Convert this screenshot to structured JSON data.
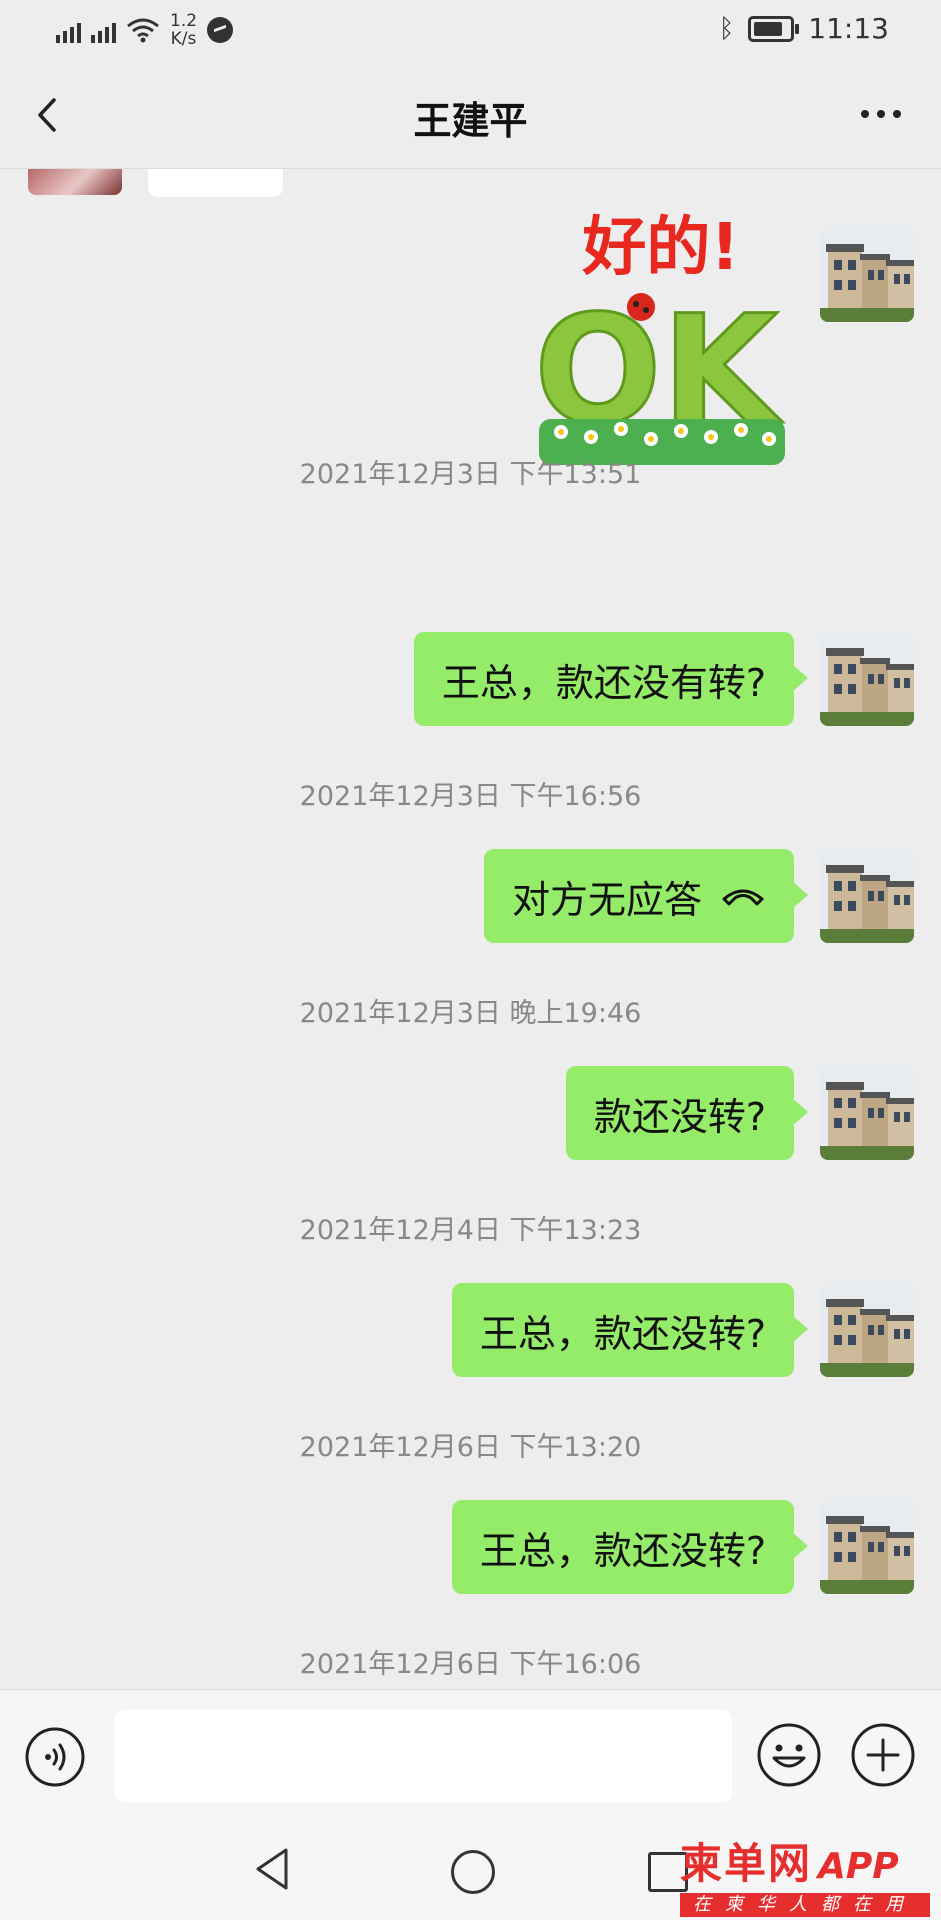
{
  "status_bar": {
    "network_1": "4G",
    "network_2": "4G",
    "speed_value": "1.2",
    "speed_unit": "K/s",
    "time": "11:13"
  },
  "header": {
    "title": "王建平"
  },
  "messages": [
    {
      "sticker_text_top": "好的!",
      "sticker_text_main": "OK"
    },
    {
      "timestamp": "2021年12月3日 下午13:51",
      "text": "王总，款还没有转?"
    },
    {
      "timestamp": "2021年12月3日 下午16:56",
      "text": "对方无应答"
    },
    {
      "timestamp": "2021年12月3日 晚上19:46",
      "text": "款还没转?"
    },
    {
      "timestamp": "2021年12月4日 下午13:23",
      "text": "王总，款还没转?"
    },
    {
      "timestamp": "2021年12月6日 下午13:20",
      "text": "王总，款还没转?"
    },
    {
      "timestamp": "2021年12月6日 下午16:06"
    }
  ],
  "watermark": {
    "main": "柬单网",
    "app": "APP",
    "sub": "在柬华人都在用"
  },
  "colors": {
    "bubble_green": "#95ec69",
    "background": "#ededed",
    "watermark_red": "#e62e2e"
  },
  "icons": [
    "back-chevron-icon",
    "more-icon",
    "voice-icon",
    "emoji-icon",
    "plus-icon",
    "call-end-icon",
    "bluetooth-icon",
    "battery-icon",
    "wifi-icon",
    "messenger-icon"
  ]
}
